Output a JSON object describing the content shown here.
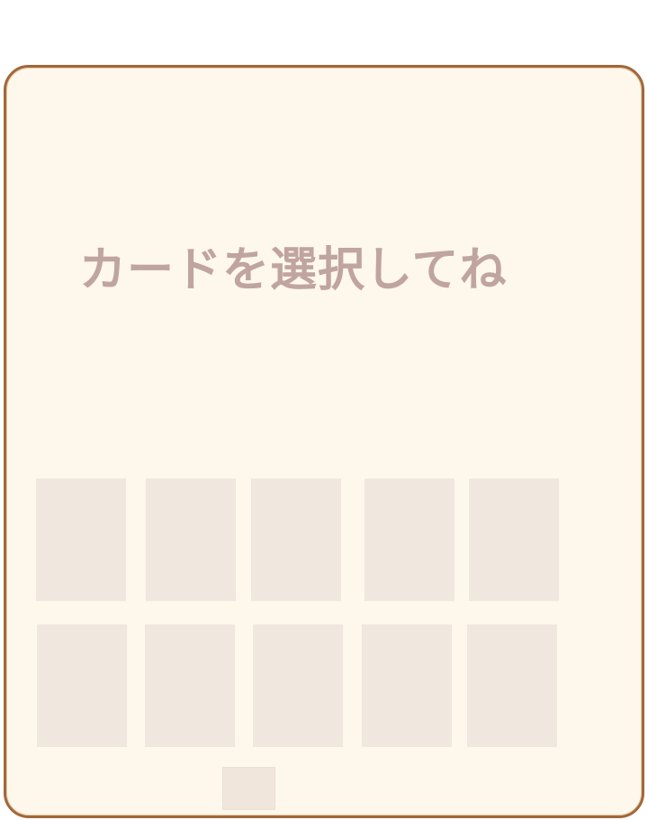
{
  "screen": {
    "prompt_text": "カードを選択してね"
  },
  "colors": {
    "background": "#ffffff",
    "panel_fill": "#fdf7ec",
    "panel_border": "#a0683c",
    "prompt_text": "#c0a49f",
    "card_placeholder": "#f0e7de"
  },
  "cards": {
    "row_1": [
      "card-1",
      "card-2",
      "card-3",
      "card-4",
      "card-5"
    ],
    "row_2": [
      "card-6",
      "card-7",
      "card-8",
      "card-9",
      "card-10"
    ]
  }
}
